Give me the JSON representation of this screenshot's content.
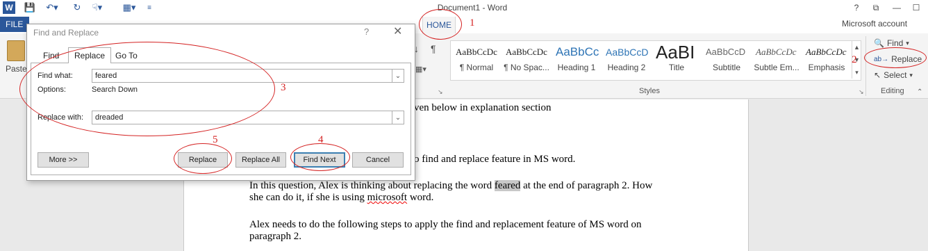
{
  "titlebar": {
    "title": "Document1 - Word",
    "help": "?",
    "restore": "⧉",
    "minimize": "—",
    "maximize": "☐"
  },
  "ribbon": {
    "file_tab": "FILE",
    "home_tab": "HOME",
    "account": "Microsoft account",
    "paste_label": "Paste",
    "styles_group_label": "Styles",
    "editing_group_label": "Editing",
    "styles": [
      {
        "sample": "AaBbCcDc",
        "name": "¶ Normal"
      },
      {
        "sample": "AaBbCcDc",
        "name": "¶ No Spac..."
      },
      {
        "sample": "AaBbCc",
        "name": "Heading 1"
      },
      {
        "sample": "AaBbCcD",
        "name": "Heading 2"
      },
      {
        "sample": "AaBI",
        "name": "Title"
      },
      {
        "sample": "AaBbCcD",
        "name": "Subtitle"
      },
      {
        "sample": "AaBbCcDc",
        "name": "Subtle Em..."
      },
      {
        "sample": "AaBbCcDc",
        "name": "Emphasis"
      }
    ],
    "editing": {
      "find": "Find",
      "replace": "Replace",
      "select": "Select"
    }
  },
  "dialog": {
    "title": "Find and Replace",
    "help": "?",
    "tabs": [
      "Find",
      "Replace",
      "Go To"
    ],
    "find_what_label": "Find what:",
    "find_what_value": "feared",
    "options_label": "Options:",
    "options_value": "Search Down",
    "replace_with_label": "Replace with:",
    "replace_with_value": "dreaded",
    "buttons": {
      "more": "More >>",
      "replace": "Replace",
      "replace_all": "Replace All",
      "find_next": "Find Next",
      "cancel": "Cancel"
    }
  },
  "document": {
    "line1": "ven below in explanation section",
    "line2": "o find and replace feature in MS word.",
    "para1_a": "In this question, Alex is thinking about replacing the word ",
    "para1_hl": "feared",
    "para1_b": " at the end of paragraph 2. How",
    "para1_c": "she can do it, if she is using ",
    "para1_sq": "microsoft",
    "para1_d": " word.",
    "para2_a": "Alex needs to do the following steps to apply the find and replacement feature of MS word on",
    "para2_b": "paragraph 2."
  },
  "annotations": [
    "1",
    "2",
    "3",
    "4",
    "5"
  ],
  "colors": {
    "word_blue": "#2b579a",
    "annotation_red": "#d42222"
  }
}
